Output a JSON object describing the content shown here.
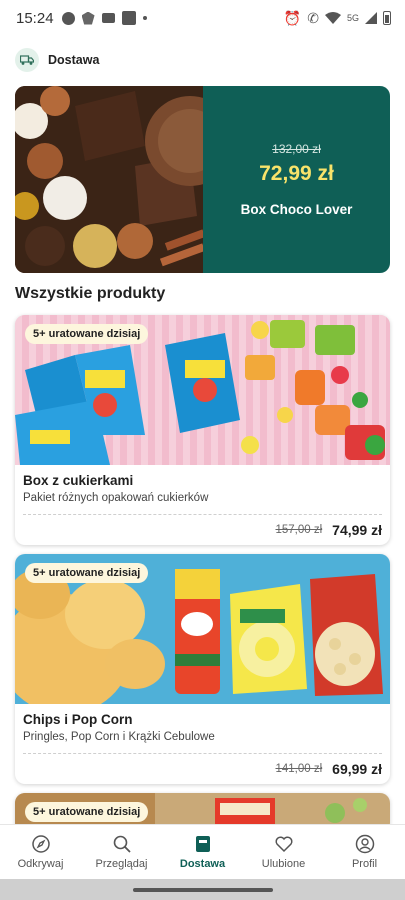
{
  "status_bar": {
    "time": "15:24",
    "network": "5G",
    "icons": [
      "message-icon",
      "eagle-icon",
      "mail-icon",
      "app-icon",
      "dot-icon",
      "alarm-icon",
      "wifi-call-icon",
      "wifi-icon",
      "signal-icon",
      "battery-icon"
    ]
  },
  "header": {
    "icon": "truck-icon",
    "title": "Dostawa"
  },
  "hero": {
    "old_price": "132,00 zł",
    "new_price": "72,99 zł",
    "name": "Box Choco Lover"
  },
  "section_title": "Wszystkie produkty",
  "products": [
    {
      "badge": "5+ uratowane dzisiaj",
      "name": "Box z cukierkami",
      "description": "Pakiet różnych opakowań cukierków",
      "old_price": "157,00 zł",
      "new_price": "74,99 zł"
    },
    {
      "badge": "5+ uratowane dzisiaj",
      "name": "Chips i Pop Corn",
      "description": "Pringles, Pop Corn i Krążki Cebulowe",
      "old_price": "141,00 zł",
      "new_price": "69,99 zł"
    },
    {
      "badge": "5+ uratowane dzisiaj"
    }
  ],
  "bottom_nav": [
    {
      "label": "Odkrywaj",
      "icon": "compass-icon",
      "active": false
    },
    {
      "label": "Przeglądaj",
      "icon": "search-icon",
      "active": false
    },
    {
      "label": "Dostawa",
      "icon": "box-icon",
      "active": true
    },
    {
      "label": "Ulubione",
      "icon": "heart-icon",
      "active": false
    },
    {
      "label": "Profil",
      "icon": "profile-icon",
      "active": false
    }
  ],
  "colors": {
    "brand": "#0f5f56",
    "price_accent": "#f8e36a",
    "badge_bg": "#fdf6dd"
  }
}
